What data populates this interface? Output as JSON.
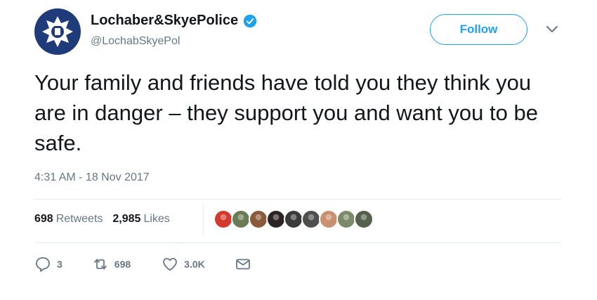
{
  "account": {
    "display_name": "Lochaber&SkyePolice",
    "handle": "@LochabSkyePol",
    "verified_icon": "verified-badge-icon",
    "brand_color": "#1da1f2"
  },
  "header": {
    "follow_label": "Follow"
  },
  "tweet": {
    "text": "Your family and friends have told you they think you are in danger – they support you and want you to be safe.",
    "timestamp": "4:31 AM - 18 Nov 2017"
  },
  "stats": {
    "retweets_count": "698",
    "retweets_label": "Retweets",
    "likes_count": "2,985",
    "likes_label": "Likes"
  },
  "likers": [
    {
      "color": "#d23a2e"
    },
    {
      "color": "#6b7b54"
    },
    {
      "color": "#8b5a3c"
    },
    {
      "color": "#2c2424"
    },
    {
      "color": "#3a3a3a"
    },
    {
      "color": "#4e4e4e"
    },
    {
      "color": "#c98f6f"
    },
    {
      "color": "#7c8a6a"
    },
    {
      "color": "#55604e"
    }
  ],
  "actions": {
    "reply_count": "3",
    "retweet_count": "698",
    "like_count": "3.0K"
  }
}
